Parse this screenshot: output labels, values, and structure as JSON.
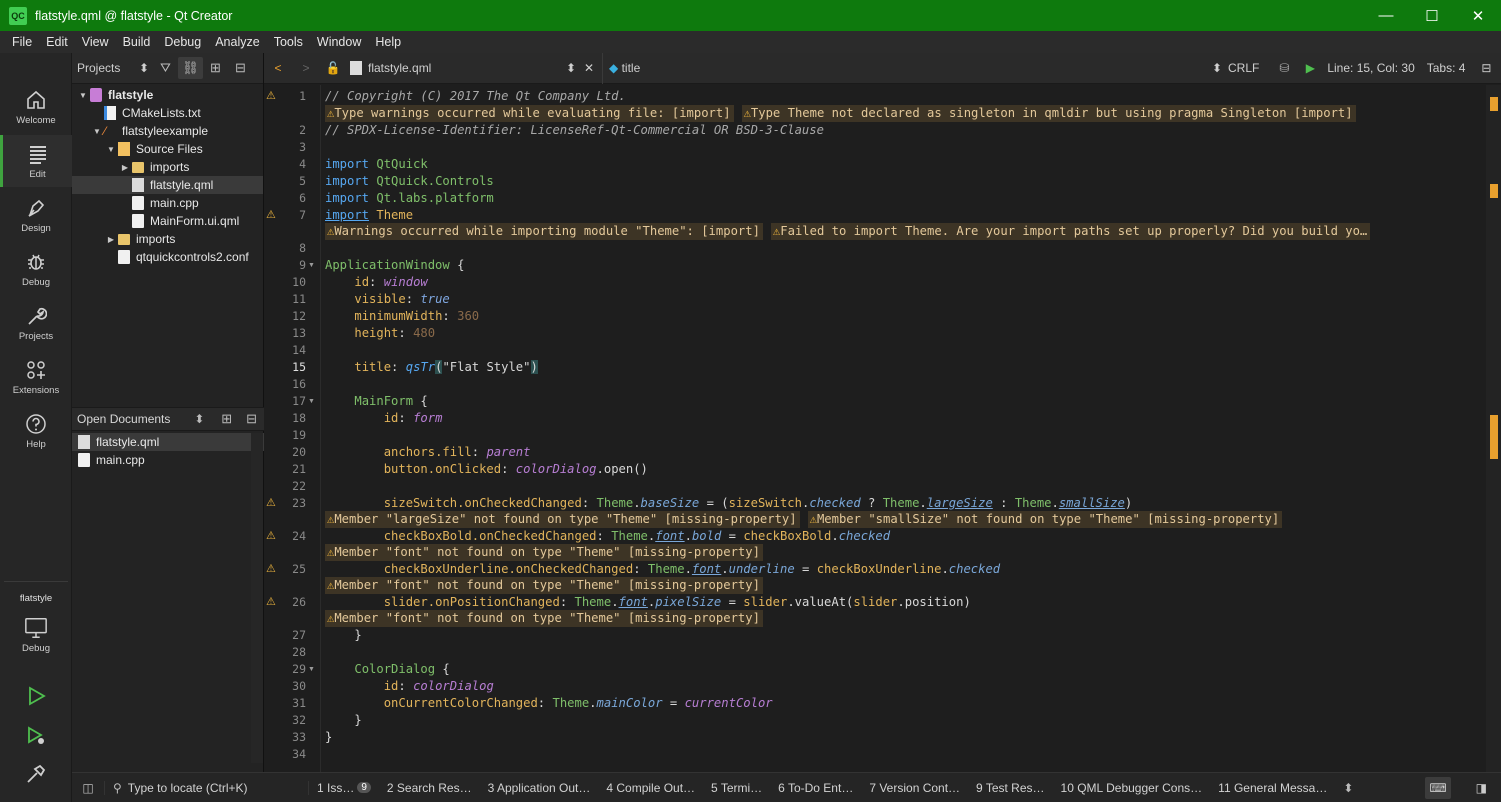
{
  "window": {
    "title": "flatstyle.qml @ flatstyle - Qt Creator",
    "icon": "QC",
    "controls": [
      "—",
      "☐",
      "✕"
    ]
  },
  "menu": [
    "File",
    "Edit",
    "View",
    "Build",
    "Debug",
    "Analyze",
    "Tools",
    "Window",
    "Help"
  ],
  "modes": [
    {
      "label": "Welcome"
    },
    {
      "label": "Edit"
    },
    {
      "label": "Design"
    },
    {
      "label": "Debug"
    },
    {
      "label": "Projects"
    },
    {
      "label": "Extensions"
    },
    {
      "label": "Help"
    }
  ],
  "kit": {
    "project": "flatstyle",
    "mode": "Debug"
  },
  "projects": {
    "selector": "Projects",
    "tree": [
      {
        "label": "flatstyle",
        "indent": 0,
        "arrow": "▼",
        "icon": "proj",
        "bold": true
      },
      {
        "label": "CMakeLists.txt",
        "indent": 1,
        "arrow": "",
        "icon": "cmake"
      },
      {
        "label": "flatstyleexample",
        "indent": 1,
        "arrow": "▼",
        "icon": "sub"
      },
      {
        "label": "Source Files",
        "indent": 2,
        "arrow": "▼",
        "icon": "srcf"
      },
      {
        "label": "imports",
        "indent": 3,
        "arrow": "▶",
        "icon": "folder"
      },
      {
        "label": "flatstyle.qml",
        "indent": 3,
        "arrow": "",
        "icon": "qml",
        "selected": true
      },
      {
        "label": "main.cpp",
        "indent": 3,
        "arrow": "",
        "icon": "file"
      },
      {
        "label": "MainForm.ui.qml",
        "indent": 3,
        "arrow": "",
        "icon": "file"
      },
      {
        "label": "imports",
        "indent": 2,
        "arrow": "▶",
        "icon": "folder"
      },
      {
        "label": "qtquickcontrols2.conf",
        "indent": 2,
        "arrow": "",
        "icon": "file"
      }
    ]
  },
  "open_documents": {
    "title": "Open Documents",
    "items": [
      {
        "label": "flatstyle.qml",
        "selected": true
      },
      {
        "label": "main.cpp"
      }
    ]
  },
  "editor_toolbar": {
    "file": "flatstyle.qml",
    "symbol": "title",
    "line_ending": "CRLF",
    "position": "Line: 15, Col: 30",
    "tabs": "Tabs: 4"
  },
  "warnings": {
    "w1a": "Type warnings occurred while evaluating file: [import]",
    "w1b": "Type Theme not declared as singleton in qmldir but using pragma Singleton [import]",
    "w7a": "Warnings occurred while importing module \"Theme\": [import]",
    "w7b": "Failed to import Theme. Are your import paths set up properly? Did you build yo…",
    "w23a": "Member \"largeSize\" not found on type \"Theme\" [missing-property]",
    "w23b": "Member \"smallSize\" not found on type \"Theme\" [missing-property]",
    "wfont": "Member \"font\" not found on type \"Theme\" [missing-property]"
  },
  "code": {
    "l1": "// Copyright (C) 2017 The Qt Company Ltd.",
    "l2": "// SPDX-License-Identifier: LicenseRef-Qt-Commercial OR BSD-3-Clause",
    "imp": "import",
    "m4": "QtQuick",
    "m5": "QtQuick.Controls",
    "m6": "Qt.labs.platform",
    "m7": "Theme",
    "appwin": "ApplicationWindow",
    "ob": " {",
    "cb": "}",
    "id": "id",
    "window": "window",
    "visible": "visible",
    "true": "true",
    "minw": "minimumWidth",
    "minwv": "360",
    "height": "height",
    "heightv": "480",
    "title": "title",
    "qstr": "qsTr",
    "titlestr": "\"Flat Style\"",
    "mainform": "MainForm",
    "form": "form",
    "anchors": "anchors",
    "fill": ".fill",
    "parent": "parent",
    "button": "button",
    "onclicked": ".onClicked",
    "colordialog_id": "colorDialog",
    "open": ".open()",
    "sizeswitch": "sizeSwitch",
    "oncheckedchanged": ".onCheckedChanged",
    "theme": "Theme",
    "basesize": "baseSize",
    "checked": "checked",
    "largesize": "largeSize",
    "smallsize": "smallSize",
    "cbbold": "checkBoxBold",
    "font": "font",
    "bold": "bold",
    "cbunder": "checkBoxUnderline",
    "underline": "underline",
    "slider": "slider",
    "onposchanged": ".onPositionChanged",
    "pixelsize": "pixelSize",
    "valueat": ".valueAt(",
    "position": "position",
    "colordialog": "ColorDialog",
    "oncolor": "onCurrentColorChanged",
    "maincolor": "mainColor",
    "currentcolor": "currentColor"
  },
  "line_numbers": [
    "1",
    "2",
    "3",
    "4",
    "5",
    "6",
    "7",
    "8",
    "9",
    "10",
    "11",
    "12",
    "13",
    "14",
    "15",
    "16",
    "17",
    "18",
    "19",
    "20",
    "21",
    "22",
    "23",
    "24",
    "25",
    "26",
    "27",
    "28",
    "29",
    "30",
    "31",
    "32",
    "33",
    "34"
  ],
  "bottom_tabs": [
    {
      "label": "1  Iss…",
      "badge": "9"
    },
    {
      "label": "2  Search Res…"
    },
    {
      "label": "3  Application Out…"
    },
    {
      "label": "4  Compile Out…"
    },
    {
      "label": "5  Termi…"
    },
    {
      "label": "6  To-Do Ent…"
    },
    {
      "label": "7  Version Cont…"
    },
    {
      "label": "9  Test Res…"
    },
    {
      "label": "10  QML Debugger Cons…"
    },
    {
      "label": "11  General Messa…"
    }
  ],
  "locator": {
    "placeholder": "Type to locate (Ctrl+K)"
  },
  "colors": {
    "titlebar": "#0e7a0d",
    "accent": "#3fa33f",
    "warning": "#e9b23d"
  }
}
